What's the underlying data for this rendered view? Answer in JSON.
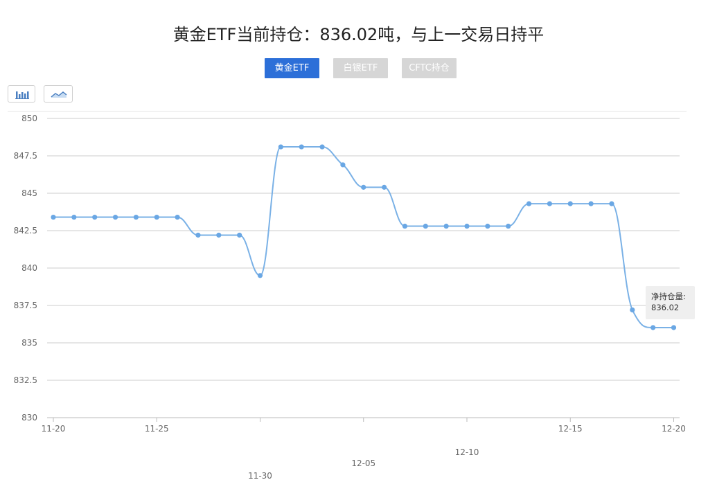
{
  "page": {
    "title": "黄金ETF当前持仓：836.02吨，与上一交易日持平"
  },
  "tabs": [
    {
      "label": "黄金ETF",
      "active": true
    },
    {
      "label": "白银ETF",
      "active": false
    },
    {
      "label": "CFTC持仓",
      "active": false
    }
  ],
  "toolbar": {
    "bar_toggle_icon": "bar-chart-icon",
    "line_toggle_icon": "line-chart-icon"
  },
  "tooltip": {
    "label": "净持仓量:",
    "value": "836.02"
  },
  "colors": {
    "accent": "#2c6fd8",
    "line": "#7ab1e6",
    "point": "#6aa7e4",
    "grid": "#cccccc",
    "tab_inactive": "#d6d6d6"
  },
  "chart_data": {
    "type": "line",
    "title": "黄金ETF当前持仓：836.02吨，与上一交易日持平",
    "xlabel": "",
    "ylabel": "",
    "ylim": [
      830,
      850
    ],
    "yticks": [
      "850",
      "847.5",
      "845",
      "842.5",
      "840",
      "837.5",
      "835",
      "832.5",
      "830"
    ],
    "xticks": [
      "11-20",
      "11-25",
      "11-30",
      "12-05",
      "12-10",
      "12-15",
      "12-20"
    ],
    "grid": true,
    "legend": "none",
    "series": [
      {
        "name": "净持仓量",
        "values": [
          843.4,
          843.4,
          843.4,
          843.4,
          843.4,
          843.4,
          843.4,
          842.2,
          842.2,
          842.2,
          839.5,
          848.1,
          848.1,
          848.1,
          846.9,
          845.4,
          845.4,
          842.8,
          842.8,
          842.8,
          842.8,
          842.8,
          842.8,
          844.3,
          844.3,
          844.3,
          844.3,
          844.3,
          837.2,
          836.02,
          836.02
        ]
      }
    ]
  }
}
